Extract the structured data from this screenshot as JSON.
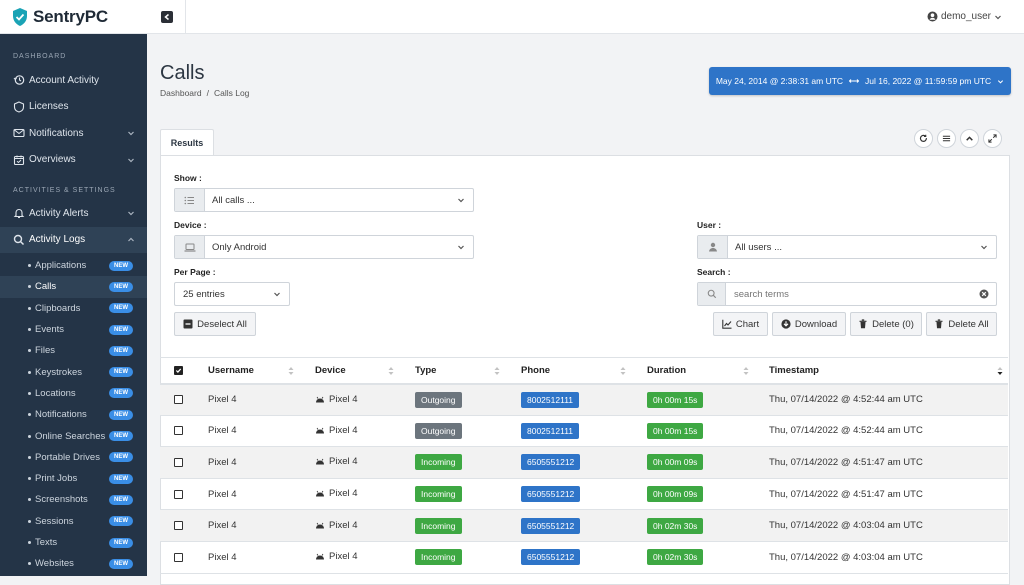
{
  "app": {
    "name": "SentryPC"
  },
  "user": {
    "name": "demo_user"
  },
  "sidebar": {
    "section1": "DASHBOARD",
    "section2": "ACTIVITIES & SETTINGS",
    "items": [
      {
        "label": "Account Activity",
        "icon": "history-icon"
      },
      {
        "label": "Licenses",
        "icon": "shield-icon"
      },
      {
        "label": "Notifications",
        "icon": "envelope-icon"
      },
      {
        "label": "Overviews",
        "icon": "calendar-check-icon"
      },
      {
        "label": "Activity Alerts",
        "icon": "bell-icon"
      },
      {
        "label": "Activity Logs",
        "icon": "search-icon"
      }
    ],
    "subitems": [
      {
        "label": "Applications",
        "badge": "NEW"
      },
      {
        "label": "Calls",
        "badge": "NEW"
      },
      {
        "label": "Clipboards",
        "badge": "NEW"
      },
      {
        "label": "Events",
        "badge": "NEW"
      },
      {
        "label": "Files",
        "badge": "NEW"
      },
      {
        "label": "Keystrokes",
        "badge": "NEW"
      },
      {
        "label": "Locations",
        "badge": "NEW"
      },
      {
        "label": "Notifications",
        "badge": "NEW"
      },
      {
        "label": "Online Searches",
        "badge": "NEW"
      },
      {
        "label": "Portable Drives",
        "badge": "NEW"
      },
      {
        "label": "Print Jobs",
        "badge": "NEW"
      },
      {
        "label": "Screenshots",
        "badge": "NEW"
      },
      {
        "label": "Sessions",
        "badge": "NEW"
      },
      {
        "label": "Texts",
        "badge": "NEW"
      },
      {
        "label": "Websites",
        "badge": "NEW"
      }
    ]
  },
  "page": {
    "title": "Calls",
    "breadcrumb": [
      "Dashboard",
      "/",
      "Calls Log"
    ],
    "date_range": {
      "start": "May 24, 2014 @ 2:38:31 am UTC",
      "end": "Jul 16, 2022 @ 11:59:59 pm UTC"
    }
  },
  "tabs": {
    "results": "Results"
  },
  "filters": {
    "show_label": "Show :",
    "show_value": "All calls ...",
    "device_label": "Device :",
    "device_value": "Only Android",
    "per_page_label": "Per Page :",
    "per_page_value": "25 entries",
    "user_label": "User :",
    "user_value": "All users ...",
    "search_label": "Search :",
    "search_placeholder": "search terms"
  },
  "actions": {
    "deselect_all": "Deselect All",
    "chart": "Chart",
    "download": "Download",
    "delete": "Delete (0)",
    "delete_all": "Delete All"
  },
  "table": {
    "columns": [
      "Username",
      "Device",
      "Type",
      "Phone",
      "Duration",
      "Timestamp"
    ],
    "rows": [
      {
        "username": "Pixel 4",
        "device": "Pixel 4",
        "type": "Outgoing",
        "phone": "8002512111",
        "duration": "0h 00m 15s",
        "timestamp": "Thu, 07/14/2022 @ 4:52:44 am UTC"
      },
      {
        "username": "Pixel 4",
        "device": "Pixel 4",
        "type": "Outgoing",
        "phone": "8002512111",
        "duration": "0h 00m 15s",
        "timestamp": "Thu, 07/14/2022 @ 4:52:44 am UTC"
      },
      {
        "username": "Pixel 4",
        "device": "Pixel 4",
        "type": "Incoming",
        "phone": "6505551212",
        "duration": "0h 00m 09s",
        "timestamp": "Thu, 07/14/2022 @ 4:51:47 am UTC"
      },
      {
        "username": "Pixel 4",
        "device": "Pixel 4",
        "type": "Incoming",
        "phone": "6505551212",
        "duration": "0h 00m 09s",
        "timestamp": "Thu, 07/14/2022 @ 4:51:47 am UTC"
      },
      {
        "username": "Pixel 4",
        "device": "Pixel 4",
        "type": "Incoming",
        "phone": "6505551212",
        "duration": "0h 02m 30s",
        "timestamp": "Thu, 07/14/2022 @ 4:03:04 am UTC"
      },
      {
        "username": "Pixel 4",
        "device": "Pixel 4",
        "type": "Incoming",
        "phone": "6505551212",
        "duration": "0h 02m 30s",
        "timestamp": "Thu, 07/14/2022 @ 4:03:04 am UTC"
      }
    ]
  },
  "colors": {
    "sidebar_bg": "#243447",
    "primary": "#2e74c8",
    "badge_outgoing": "#6c757d",
    "badge_incoming": "#3ea843",
    "badge_phone": "#2e74c8",
    "badge_duration": "#3ea843",
    "badge_new": "#3a8ee6"
  }
}
